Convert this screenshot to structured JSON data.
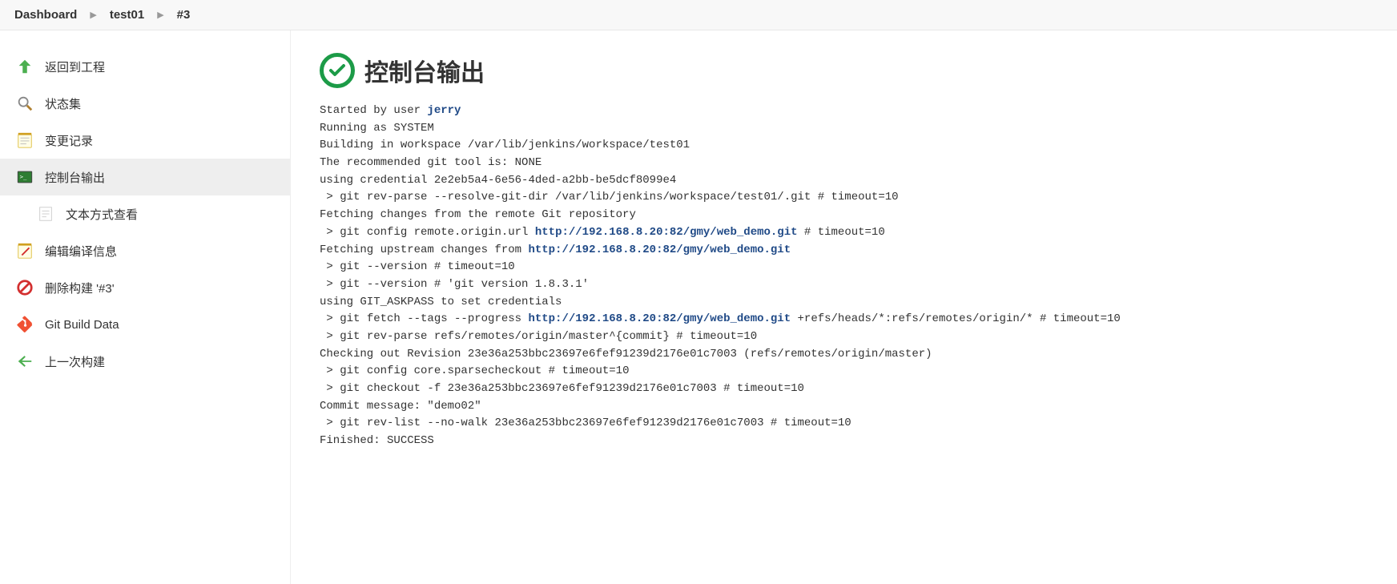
{
  "breadcrumb": {
    "dashboard": "Dashboard",
    "job": "test01",
    "build": "#3"
  },
  "sidebar": {
    "back": "返回到工程",
    "status": "状态集",
    "changes": "变更记录",
    "console": "控制台输出",
    "plaintext": "文本方式查看",
    "edit_build": "编辑编译信息",
    "delete_build": "删除构建 '#3'",
    "git_data": "Git Build Data",
    "prev_build": "上一次构建"
  },
  "page": {
    "title": "控制台输出"
  },
  "console": {
    "user_prefix": "Started by user ",
    "user_name": "jerry",
    "l2": "Running as SYSTEM",
    "l3": "Building in workspace /var/lib/jenkins/workspace/test01",
    "l4": "The recommended git tool is: NONE",
    "l5": "using credential 2e2eb5a4-6e56-4ded-a2bb-be5dcf8099e4",
    "l6": " > git rev-parse --resolve-git-dir /var/lib/jenkins/workspace/test01/.git # timeout=10",
    "l7": "Fetching changes from the remote Git repository",
    "l8a": " > git config remote.origin.url ",
    "url1": "http://192.168.8.20:82/gmy/web_demo.git",
    "l8b": " # timeout=10",
    "l9a": "Fetching upstream changes from ",
    "url2": "http://192.168.8.20:82/gmy/web_demo.git",
    "l10": " > git --version # timeout=10",
    "l11": " > git --version # 'git version 1.8.3.1'",
    "l12": "using GIT_ASKPASS to set credentials ",
    "l13a": " > git fetch --tags --progress ",
    "url3": "http://192.168.8.20:82/gmy/web_demo.git",
    "l13b": " +refs/heads/*:refs/remotes/origin/* # timeout=10",
    "l14": " > git rev-parse refs/remotes/origin/master^{commit} # timeout=10",
    "l15": "Checking out Revision 23e36a253bbc23697e6fef91239d2176e01c7003 (refs/remotes/origin/master)",
    "l16": " > git config core.sparsecheckout # timeout=10",
    "l17": " > git checkout -f 23e36a253bbc23697e6fef91239d2176e01c7003 # timeout=10",
    "l18": "Commit message: \"demo02\"",
    "l19": " > git rev-list --no-walk 23e36a253bbc23697e6fef91239d2176e01c7003 # timeout=10",
    "l20": "Finished: SUCCESS"
  }
}
